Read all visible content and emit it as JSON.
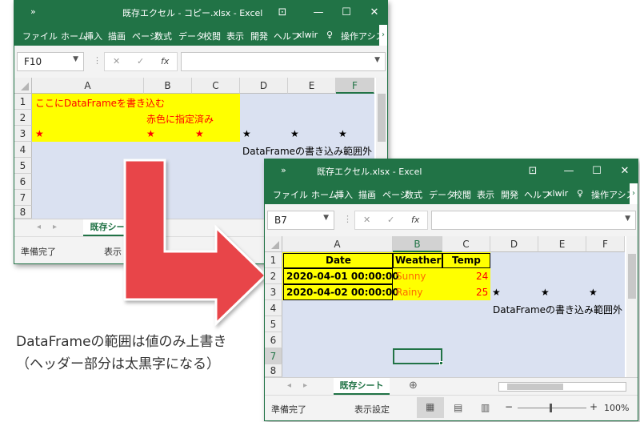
{
  "back_window": {
    "title": "既存エクセル - コピー.xlsx  -  Excel",
    "qa_icon": "»",
    "ribbon_tabs": [
      "ファイル",
      "ホーム",
      "挿入",
      "描画",
      "ページ",
      "数式",
      "データ",
      "校閲",
      "表示",
      "開発",
      "ヘルフ",
      "xlwir",
      "操作アシス"
    ],
    "name_box": "F10",
    "columns": [
      "A",
      "B",
      "C",
      "D",
      "E",
      "F"
    ],
    "rows": [
      "1",
      "2",
      "3",
      "4",
      "5",
      "6",
      "7",
      "8"
    ],
    "cells": {
      "a1": "ここにDataFrameを書き込む",
      "b2": "赤色に指定済み",
      "star": "★",
      "d4": "DataFrameの書き込み範囲外"
    },
    "sheet_tab": "既存シート",
    "status": "準備完了",
    "display_settings": "表示"
  },
  "front_window": {
    "title": "既存エクセル.xlsx  -  Excel",
    "qa_icon": "»",
    "ribbon_tabs": [
      "ファイル",
      "ホーム",
      "挿入",
      "描画",
      "ページ",
      "数式",
      "データ",
      "校閲",
      "表示",
      "開発",
      "ヘルフ",
      "xlwir",
      "操作アシス"
    ],
    "name_box": "B7",
    "columns": [
      "A",
      "B",
      "C",
      "D",
      "E",
      "F"
    ],
    "rows": [
      "1",
      "2",
      "3",
      "4",
      "5",
      "6",
      "7",
      "8"
    ],
    "cells": {
      "a1": "Date",
      "b1": "Weather",
      "c1": "Temp",
      "a2": "2020-04-01 00:00:00",
      "b2": "Sunny",
      "c2": "24",
      "a3": "2020-04-02 00:00:00",
      "b3": "Rainy",
      "c3": "25",
      "star": "★",
      "d4": "DataFrameの書き込み範囲外"
    },
    "sheet_tab": "既存シート",
    "status": "準備完了",
    "display_settings": "表示設定",
    "zoom": "100%"
  },
  "caption": {
    "line1": "DataFrameの範囲は値のみ上書き",
    "line2": "（ヘッダー部分は太黒字になる）"
  },
  "colors": {
    "excel_green": "#217346",
    "cell_bg": "#dae1f1",
    "highlight": "#ffff00",
    "arrow": "#e8444a",
    "red_text": "#ff0000",
    "orange_text": "#ff6a00"
  }
}
